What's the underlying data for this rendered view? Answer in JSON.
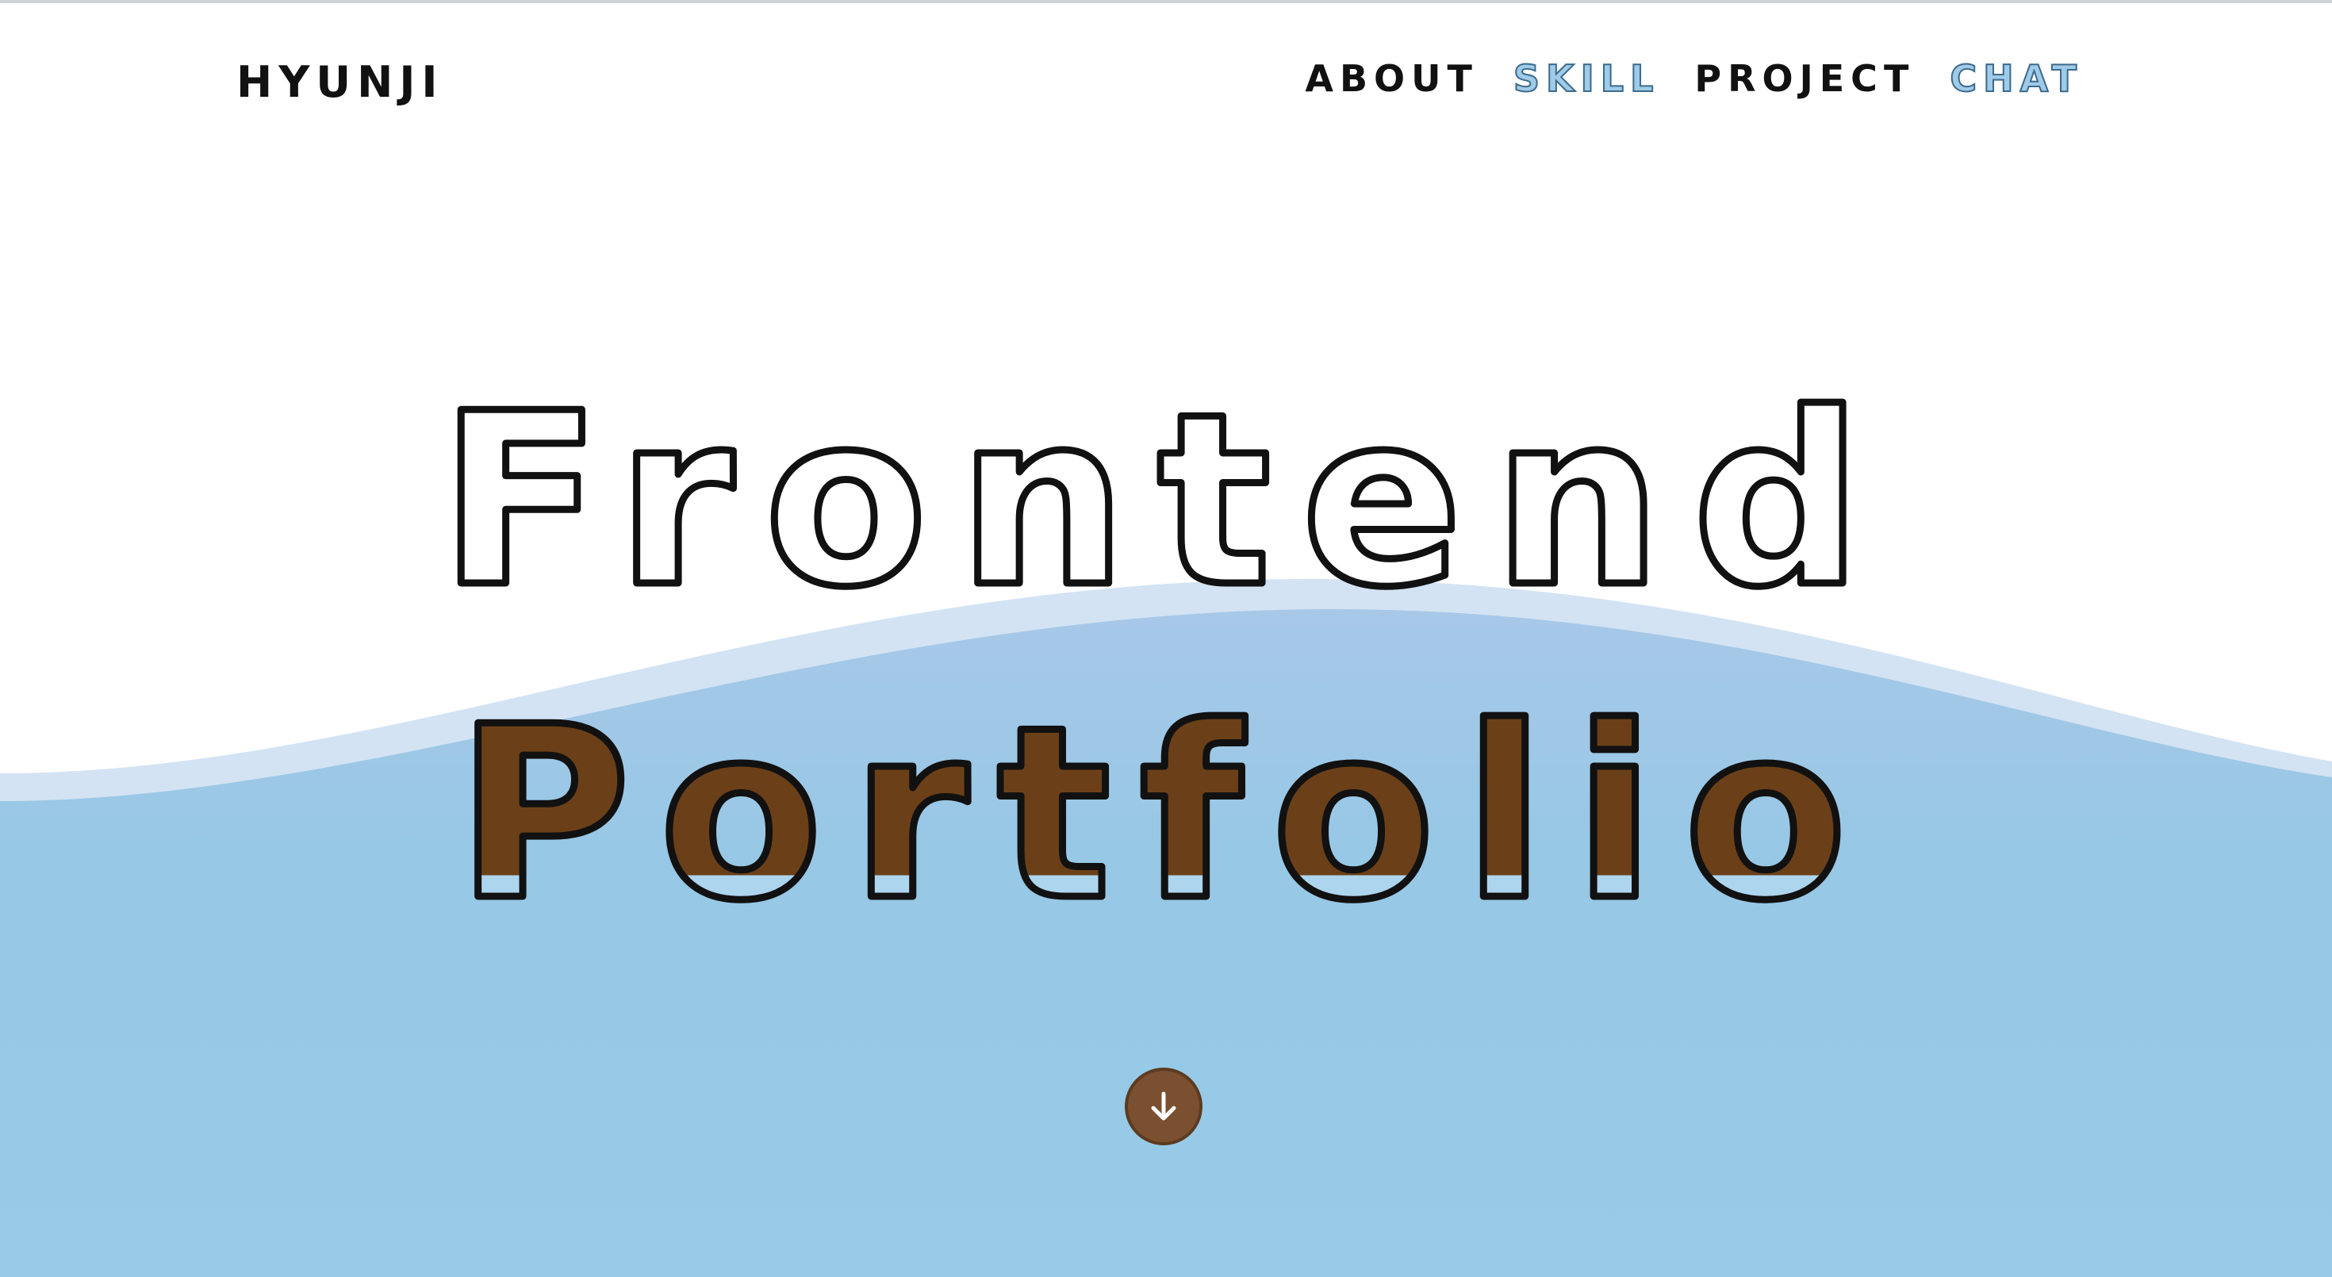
{
  "header": {
    "logo": "HYUNJI",
    "nav": [
      {
        "label": "ABOUT",
        "style": "dark"
      },
      {
        "label": "SKILL",
        "style": "light"
      },
      {
        "label": "PROJECT",
        "style": "dark"
      },
      {
        "label": "CHAT",
        "style": "light"
      }
    ]
  },
  "hero": {
    "line1": "Frontend",
    "line2": "Portfolio"
  },
  "colors": {
    "water": "#97c8e5",
    "water_light": "#cfe2f3",
    "fill_brown": "#6b4018",
    "outline": "#111111",
    "button": "#7a5030"
  },
  "icons": {
    "scroll": "arrow-down-icon"
  }
}
